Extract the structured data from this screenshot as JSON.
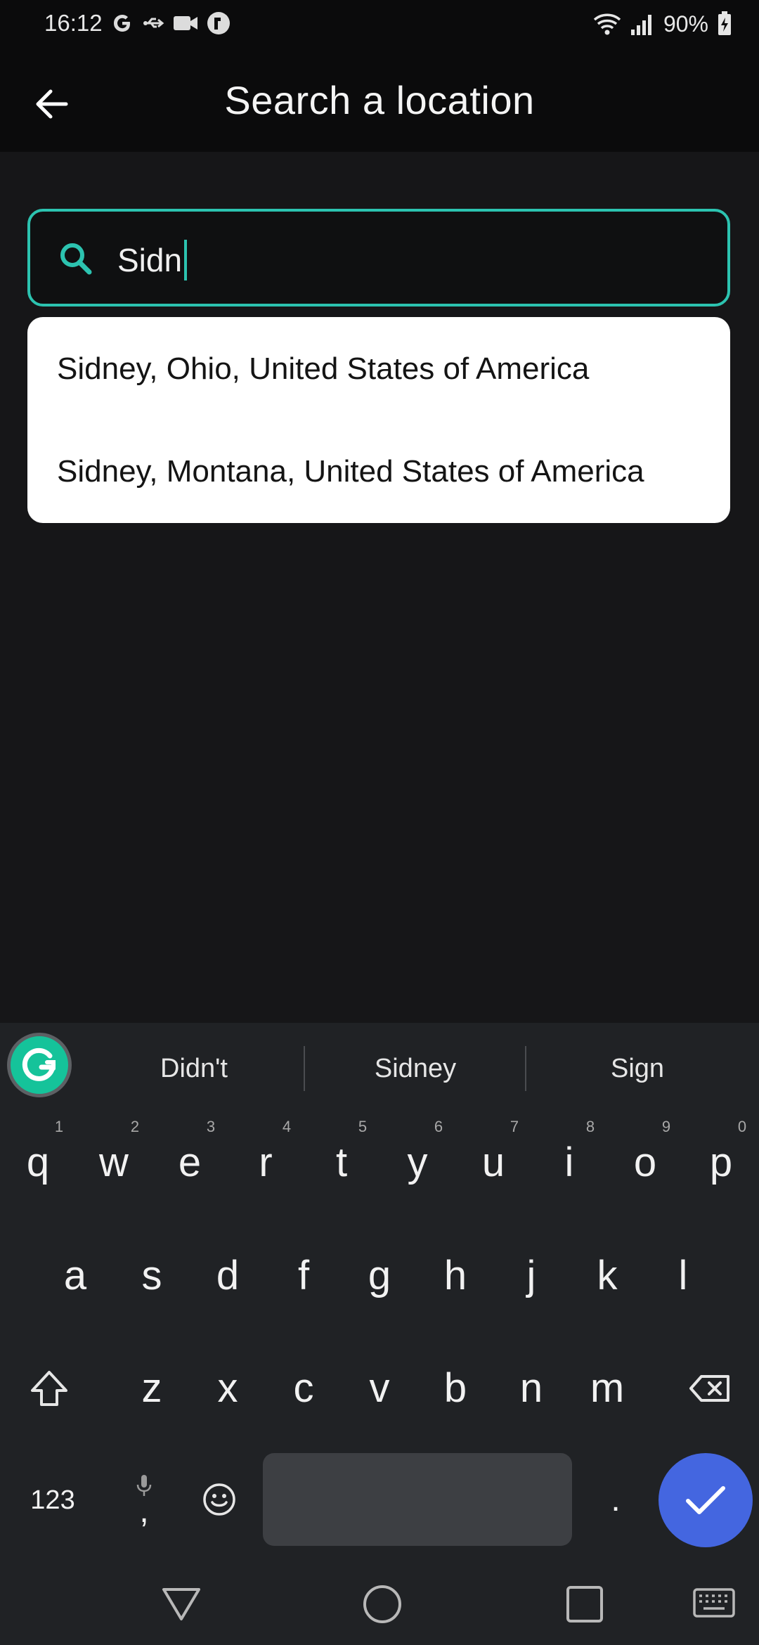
{
  "status_bar": {
    "time": "16:12",
    "battery": "90%",
    "left_icons": [
      "google-icon",
      "usb-icon",
      "video-icon",
      "app-notification-icon"
    ],
    "right_icons": [
      "wifi-icon",
      "signal-icon",
      "battery-charging-icon"
    ]
  },
  "app_bar": {
    "title": "Search a location",
    "back_icon": "arrow-left-icon"
  },
  "search": {
    "value": "Sidn",
    "icon": "search-icon",
    "accent_color": "#2cc3b0"
  },
  "suggestions": [
    {
      "label": "Sidney, Ohio, United States of America"
    },
    {
      "label": "Sidney, Montana, United States of America"
    }
  ],
  "keyboard": {
    "predictions": [
      "Didn't",
      "Sidney",
      "Sign"
    ],
    "row1": [
      {
        "hint": "1",
        "ch": "q"
      },
      {
        "hint": "2",
        "ch": "w"
      },
      {
        "hint": "3",
        "ch": "e"
      },
      {
        "hint": "4",
        "ch": "r"
      },
      {
        "hint": "5",
        "ch": "t"
      },
      {
        "hint": "6",
        "ch": "y"
      },
      {
        "hint": "7",
        "ch": "u"
      },
      {
        "hint": "8",
        "ch": "i"
      },
      {
        "hint": "9",
        "ch": "o"
      },
      {
        "hint": "0",
        "ch": "p"
      }
    ],
    "row2": [
      "a",
      "s",
      "d",
      "f",
      "g",
      "h",
      "j",
      "k",
      "l"
    ],
    "row3": [
      "z",
      "x",
      "c",
      "v",
      "b",
      "n",
      "m"
    ],
    "symbols_key": "123",
    "comma_key": ",",
    "period_key": ".",
    "done_color": "#4466e0"
  },
  "nav_bar": {
    "buttons": [
      "back-triangle-icon",
      "home-circle-icon",
      "recents-square-icon",
      "keyboard-toggle-icon"
    ]
  }
}
